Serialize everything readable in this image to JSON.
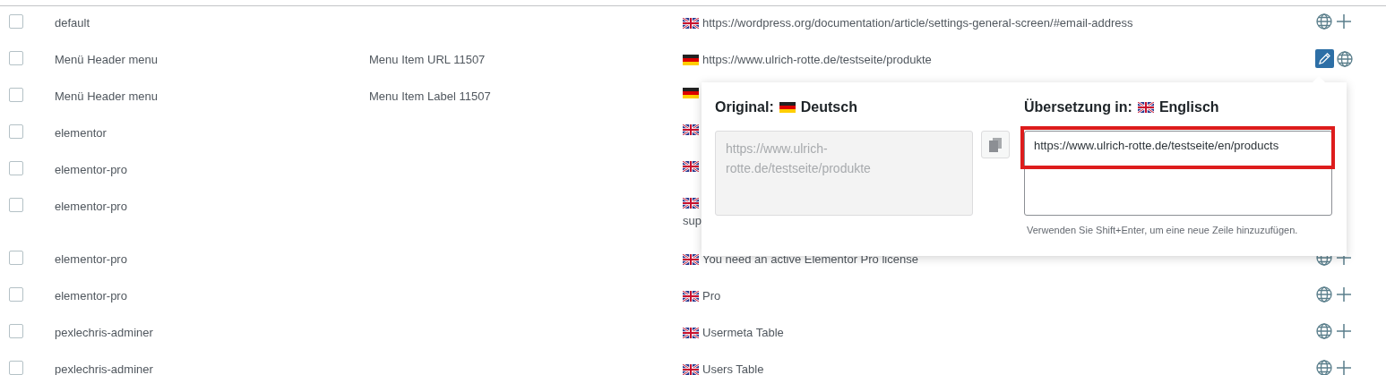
{
  "rows": [
    {
      "checked": false,
      "domain": "default",
      "context": null,
      "original": {
        "kind": "british",
        "text": "https://wordpress.org/documentation/article/settings-general-screen/#email-address"
      },
      "actions": [
        {
          "kind": "globe",
          "selected": false
        },
        {
          "kind": "plus",
          "selected": false
        }
      ]
    },
    {
      "checked": false,
      "domain": "Menü Header menu",
      "context": "Menu Item URL 11507",
      "original": {
        "kind": "german",
        "text": "https://www.ulrich-rotte.de/testseite/produkte"
      },
      "actions": [
        {
          "kind": "edit",
          "selected": true
        },
        {
          "kind": "globe",
          "selected": false
        }
      ]
    },
    {
      "checked": false,
      "domain": "Menü Header menu",
      "context": "Menu Item Label 11507",
      "original": {
        "kind": "german"
      }
    },
    {
      "checked": false,
      "domain": "elementor",
      "original": {
        "kind": "british"
      }
    },
    {
      "checked": false,
      "domain": "elementor-pro",
      "original": {
        "kind": "british"
      }
    },
    {
      "checked": false,
      "domain": "elementor-pro",
      "original": {
        "kind": "british",
        "continuation": "sup"
      }
    },
    {
      "checked": false,
      "domain": "elementor-pro",
      "original": {
        "kind": "british",
        "text": "You need an active Elementor Pro license"
      },
      "actions": [
        {
          "kind": "globe",
          "selected": false
        },
        {
          "kind": "plus",
          "selected": false
        }
      ]
    },
    {
      "checked": false,
      "domain": "elementor-pro",
      "original": {
        "kind": "british",
        "text": "Pro"
      },
      "actions": [
        {
          "kind": "globe",
          "selected": false
        },
        {
          "kind": "plus",
          "selected": false
        }
      ]
    },
    {
      "checked": false,
      "domain": "pexlechris-adminer",
      "original": {
        "kind": "british",
        "text": "Usermeta Table"
      },
      "actions": [
        {
          "kind": "globe",
          "selected": false
        },
        {
          "kind": "plus",
          "selected": false
        }
      ]
    },
    {
      "checked": false,
      "domain": "pexlechris-adminer",
      "original": {
        "kind": "british",
        "text": "Users Table"
      },
      "actions": [
        {
          "kind": "globe",
          "selected": false
        },
        {
          "kind": "plus",
          "selected": false
        }
      ]
    }
  ],
  "popover": {
    "source": {
      "label": "Original:",
      "kind": "german",
      "language": "Deutsch"
    },
    "original_text": "https://www.ulrich-rotte.de/testseite/produkte",
    "target": {
      "label": "Übersetzung in:",
      "kind": "british",
      "language": "Englisch"
    },
    "translation_value": "https://www.ulrich-rotte.de/testseite/en/products",
    "hint": "Verwenden Sie Shift+Enter, um eine neue Zeile hinzuzufügen.",
    "highlighted": true
  }
}
